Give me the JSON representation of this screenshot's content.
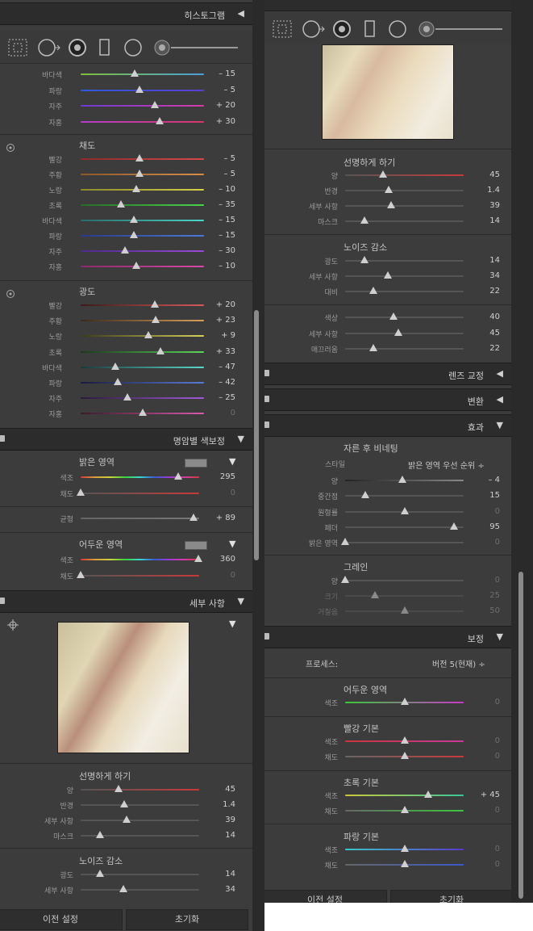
{
  "colors": {
    "accent": "#cfcfcf",
    "panel": "#3c3c3c",
    "header": "#2c2c2c"
  },
  "left": {
    "histogram_header": "히스토그램",
    "hue_top_rows": [
      {
        "label": "바다색",
        "value": "– 15",
        "colors": [
          "#7fbf3a",
          "#4aa0d6"
        ],
        "pos": 0.44
      },
      {
        "label": "파랑",
        "value": "– 5",
        "colors": [
          "#2f5ad4",
          "#5a3fd0"
        ],
        "pos": 0.48
      },
      {
        "label": "자주",
        "value": "+ 20",
        "colors": [
          "#6a3cd0",
          "#d43ca8"
        ],
        "pos": 0.6
      },
      {
        "label": "자홍",
        "value": "+ 30",
        "colors": [
          "#b43cc8",
          "#d4386a"
        ],
        "pos": 0.64
      }
    ],
    "saturation": {
      "title": "채도",
      "rows": [
        {
          "label": "빨강",
          "value": "– 5",
          "colors": [
            "#8a2a2a",
            "#d64a4a"
          ],
          "pos": 0.48
        },
        {
          "label": "주황",
          "value": "– 5",
          "colors": [
            "#8a5a2a",
            "#d6904a"
          ],
          "pos": 0.48
        },
        {
          "label": "노랑",
          "value": "– 10",
          "colors": [
            "#8a8a2a",
            "#d6d04a"
          ],
          "pos": 0.45
        },
        {
          "label": "초록",
          "value": "– 35",
          "colors": [
            "#2a6a2a",
            "#4ad64a"
          ],
          "pos": 0.33
        },
        {
          "label": "바다색",
          "value": "– 15",
          "colors": [
            "#2a6a6a",
            "#4ad6c8"
          ],
          "pos": 0.43
        },
        {
          "label": "파랑",
          "value": "– 15",
          "colors": [
            "#2a3a8a",
            "#4a7ad6"
          ],
          "pos": 0.43
        },
        {
          "label": "자주",
          "value": "– 30",
          "colors": [
            "#4a2a8a",
            "#9a4ad6"
          ],
          "pos": 0.36
        },
        {
          "label": "자홍",
          "value": "– 10",
          "colors": [
            "#8a2a6a",
            "#d64aa8"
          ],
          "pos": 0.45
        }
      ]
    },
    "luminance": {
      "title": "광도",
      "rows": [
        {
          "label": "빨강",
          "value": "+ 20",
          "colors": [
            "#3a1a1a",
            "#d65a5a"
          ],
          "pos": 0.6
        },
        {
          "label": "주황",
          "value": "+ 23",
          "colors": [
            "#3a2a1a",
            "#d6a05a"
          ],
          "pos": 0.61
        },
        {
          "label": "노랑",
          "value": "+ 9",
          "colors": [
            "#3a3a1a",
            "#d6d05a"
          ],
          "pos": 0.55
        },
        {
          "label": "초록",
          "value": "+ 33",
          "colors": [
            "#1a3a1a",
            "#5ad65a"
          ],
          "pos": 0.65
        },
        {
          "label": "바다색",
          "value": "– 47",
          "colors": [
            "#1a3a3a",
            "#5ad6c8"
          ],
          "pos": 0.28
        },
        {
          "label": "파랑",
          "value": "– 42",
          "colors": [
            "#1a1a3a",
            "#5a7ad6"
          ],
          "pos": 0.3
        },
        {
          "label": "자주",
          "value": "– 25",
          "colors": [
            "#2a1a3a",
            "#a05ad6"
          ],
          "pos": 0.38
        },
        {
          "label": "자홍",
          "value": "0",
          "colors": [
            "#3a1a2a",
            "#d65aa8"
          ],
          "pos": 0.5,
          "dim": true
        }
      ]
    },
    "split_toning": {
      "header": "명암별 색보정",
      "highlights_title": "밝은 영역",
      "highlights": [
        {
          "label": "색조",
          "value": "295",
          "pos": 0.82,
          "rainbow": true
        },
        {
          "label": "채도",
          "value": "0",
          "pos": 0.0,
          "dim": true,
          "colors": [
            "#555",
            "#c83a3a"
          ]
        }
      ],
      "balance": {
        "label": "균형",
        "value": "+ 89",
        "pos": 0.95,
        "colors": [
          "#666",
          "#777"
        ]
      },
      "shadows_title": "어두운 영역",
      "shadows": [
        {
          "label": "색조",
          "value": "360",
          "pos": 0.99,
          "rainbow": true
        },
        {
          "label": "채도",
          "value": "0",
          "pos": 0.0,
          "dim": true,
          "colors": [
            "#555",
            "#c83a3a"
          ]
        }
      ]
    },
    "detail": {
      "header": "세부 사항",
      "sharpen_title": "선명하게 하기",
      "sharpen": [
        {
          "label": "양",
          "value": "45",
          "pos": 0.32,
          "colors": [
            "#555",
            "#c83a3a"
          ]
        },
        {
          "label": "반경",
          "value": "1.4",
          "pos": 0.37,
          "colors": [
            "#555",
            "#555"
          ]
        },
        {
          "label": "세부 사항",
          "value": "39",
          "pos": 0.39,
          "colors": [
            "#555",
            "#555"
          ]
        },
        {
          "label": "마스크",
          "value": "14",
          "pos": 0.16,
          "colors": [
            "#555",
            "#555"
          ]
        }
      ],
      "noise_title": "노이즈 감소",
      "noise": [
        {
          "label": "광도",
          "value": "14",
          "pos": 0.16,
          "colors": [
            "#555",
            "#555"
          ]
        },
        {
          "label": "세부 사항",
          "value": "34",
          "pos": 0.36,
          "colors": [
            "#555",
            "#555"
          ]
        }
      ]
    },
    "footer": {
      "previous": "이전 설정",
      "reset": "초기화"
    }
  },
  "right": {
    "sharpen_title": "선명하게 하기",
    "sharpen": [
      {
        "label": "양",
        "value": "45",
        "pos": 0.32,
        "colors": [
          "#555",
          "#c83a3a"
        ]
      },
      {
        "label": "반경",
        "value": "1.4",
        "pos": 0.37,
        "colors": [
          "#555",
          "#555"
        ]
      },
      {
        "label": "세부 사항",
        "value": "39",
        "pos": 0.39,
        "colors": [
          "#555",
          "#555"
        ]
      },
      {
        "label": "마스크",
        "value": "14",
        "pos": 0.16,
        "colors": [
          "#555",
          "#555"
        ]
      }
    ],
    "noise_title": "노이즈 감소",
    "noise": [
      {
        "label": "광도",
        "value": "14",
        "pos": 0.16,
        "colors": [
          "#555",
          "#555"
        ]
      },
      {
        "label": "세부 사항",
        "value": "34",
        "pos": 0.36,
        "colors": [
          "#555",
          "#555"
        ]
      },
      {
        "label": "대비",
        "value": "22",
        "pos": 0.24,
        "colors": [
          "#555",
          "#555"
        ]
      }
    ],
    "color_noise": [
      {
        "label": "색상",
        "value": "40",
        "pos": 0.41,
        "colors": [
          "#555",
          "#555"
        ]
      },
      {
        "label": "세부 사항",
        "value": "45",
        "pos": 0.45,
        "colors": [
          "#555",
          "#555"
        ]
      },
      {
        "label": "매끄러움",
        "value": "22",
        "pos": 0.24,
        "colors": [
          "#555",
          "#555"
        ]
      }
    ],
    "lens_header": "렌즈 교정",
    "transform_header": "변환",
    "effects_header": "효과",
    "vignette_title": "자른 후 비네팅",
    "style_label": "스타일",
    "style_value": "밝은 영역 우선 순위 ÷",
    "vignette": [
      {
        "label": "양",
        "value": "– 4",
        "pos": 0.48,
        "colors": [
          "#222",
          "#888"
        ]
      },
      {
        "label": "중간점",
        "value": "15",
        "pos": 0.17,
        "colors": [
          "#555",
          "#555"
        ]
      },
      {
        "label": "원형률",
        "value": "0",
        "pos": 0.5,
        "colors": [
          "#555",
          "#555"
        ],
        "dim": true
      },
      {
        "label": "페더",
        "value": "95",
        "pos": 0.92,
        "colors": [
          "#555",
          "#555"
        ]
      },
      {
        "label": "밝은 영역",
        "value": "0",
        "pos": 0.0,
        "colors": [
          "#555",
          "#555"
        ],
        "dim": true
      }
    ],
    "grain_title": "그레인",
    "grain": [
      {
        "label": "양",
        "value": "0",
        "pos": 0.0,
        "colors": [
          "#555",
          "#555"
        ],
        "dim": true
      },
      {
        "label": "크기",
        "value": "25",
        "pos": 0.25,
        "colors": [
          "#4a4a4a",
          "#4a4a4a"
        ],
        "dim": true,
        "dimlbl": true
      },
      {
        "label": "거칠음",
        "value": "50",
        "pos": 0.5,
        "colors": [
          "#4a4a4a",
          "#4a4a4a"
        ],
        "dim": true,
        "dimlbl": true
      }
    ],
    "calibration_header": "보정",
    "process_label": "프로세스:",
    "process_value": "버전 5(현재) ÷",
    "cal_shadow_title": "어두운 영역",
    "cal_shadow": [
      {
        "label": "색조",
        "value": "0",
        "pos": 0.5,
        "colors": [
          "#3ac83a",
          "#c83ac8"
        ],
        "dim": true
      }
    ],
    "red_title": "빨강 기본",
    "red": [
      {
        "label": "색조",
        "value": "0",
        "pos": 0.5,
        "colors": [
          "#c8363a",
          "#c83a9a"
        ],
        "dim": true
      },
      {
        "label": "채도",
        "value": "0",
        "pos": 0.5,
        "colors": [
          "#666",
          "#c83a3a"
        ],
        "dim": true
      }
    ],
    "green_title": "초록 기본",
    "green": [
      {
        "label": "색조",
        "value": "+ 45",
        "pos": 0.7,
        "colors": [
          "#c8c83a",
          "#3ac89a"
        ]
      },
      {
        "label": "채도",
        "value": "0",
        "pos": 0.5,
        "colors": [
          "#666",
          "#3ac83a"
        ],
        "dim": true
      }
    ],
    "blue_title": "파랑 기본",
    "blue": [
      {
        "label": "색조",
        "value": "0",
        "pos": 0.5,
        "colors": [
          "#3ac8c8",
          "#5a3ac8"
        ],
        "dim": true
      },
      {
        "label": "채도",
        "value": "0",
        "pos": 0.5,
        "colors": [
          "#666",
          "#3a5ac8"
        ],
        "dim": true
      }
    ],
    "footer": {
      "previous": "이전 설정",
      "reset": "초기화"
    }
  }
}
